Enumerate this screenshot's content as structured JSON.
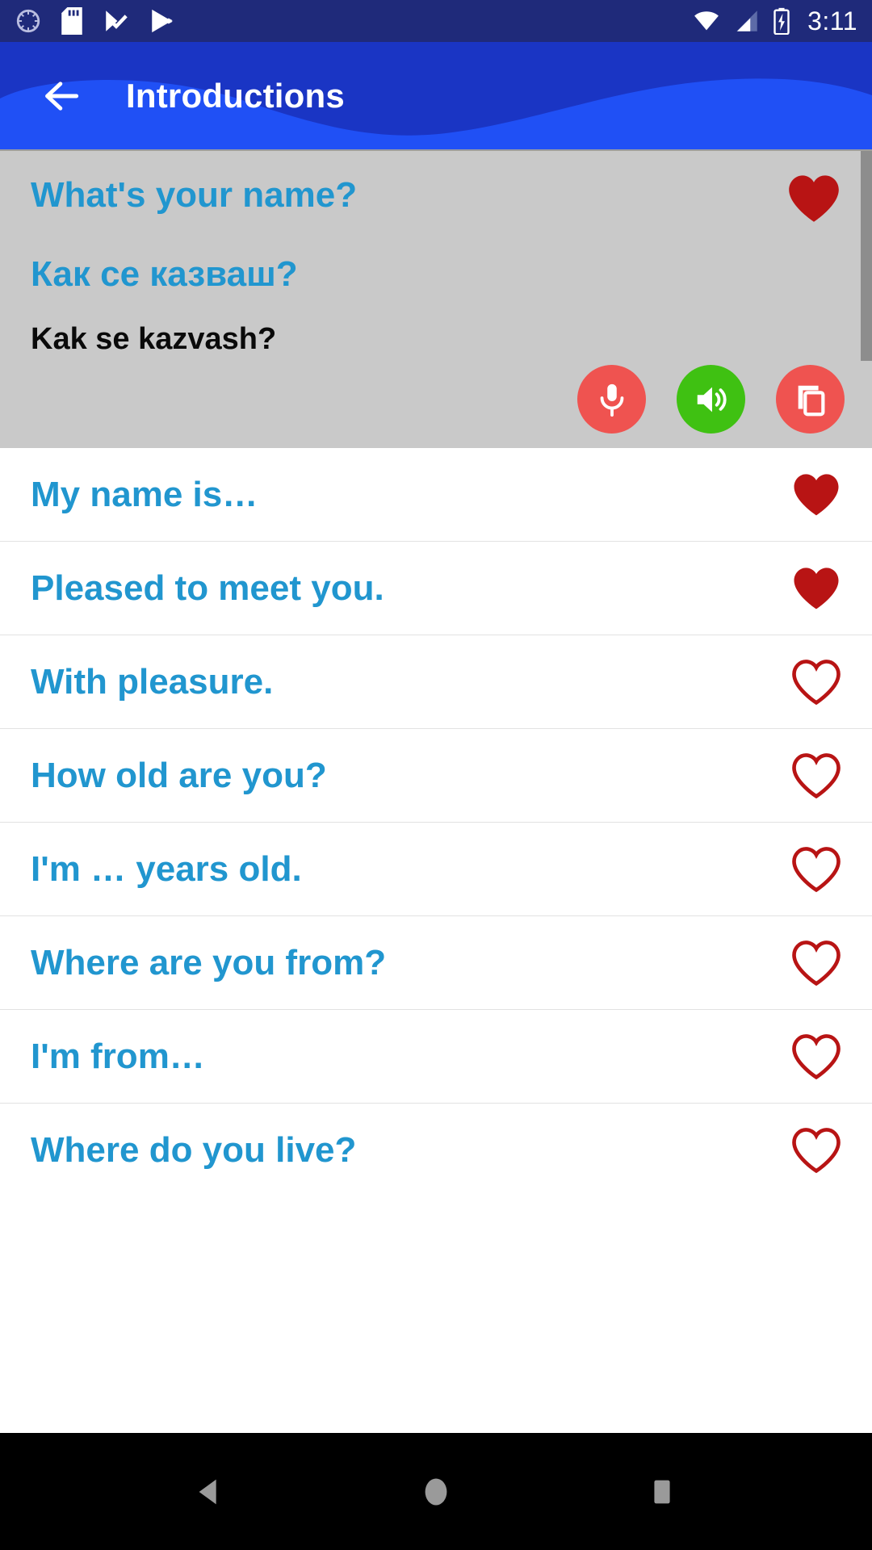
{
  "status_bar": {
    "time": "3:11",
    "left_icons": [
      {
        "name": "sync-circle-icon"
      },
      {
        "name": "sd-card-icon"
      },
      {
        "name": "video-check-icon"
      },
      {
        "name": "play-store-icon"
      }
    ],
    "right_icons": [
      {
        "name": "wifi-icon"
      },
      {
        "name": "cellular-signal-icon"
      },
      {
        "name": "battery-charging-icon"
      }
    ],
    "background_color": "#1f2a7a"
  },
  "app_bar": {
    "title": "Introductions",
    "back_icon": "arrow-left-icon",
    "background_color": "#1a35c4",
    "wave_color": "#2050f5"
  },
  "featured_card": {
    "english": "What's your name?",
    "native": "Как се казваш?",
    "transliteration": "Kak se kazvash?",
    "favorited": true,
    "heart_color": "#b81414",
    "background_color": "#c9c9c9",
    "text_color": "#2196cf",
    "translit_color": "#0a0a0a",
    "actions": [
      {
        "name": "record-button",
        "icon": "microphone-icon",
        "color": "#ef5350"
      },
      {
        "name": "play-audio-button",
        "icon": "speaker-icon",
        "color": "#3fc112"
      },
      {
        "name": "copy-button",
        "icon": "copy-icon",
        "color": "#ef5350"
      }
    ]
  },
  "phrase_list": {
    "accent_color": "#2196cf",
    "heart_color": "#b81414",
    "items": [
      {
        "label": "My name is…",
        "favorited": true
      },
      {
        "label": "Pleased to meet you.",
        "favorited": true
      },
      {
        "label": "With pleasure.",
        "favorited": false
      },
      {
        "label": "How old are you?",
        "favorited": false
      },
      {
        "label": "I'm … years old.",
        "favorited": false
      },
      {
        "label": "Where are you from?",
        "favorited": false
      },
      {
        "label": "I'm from…",
        "favorited": false
      },
      {
        "label": "Where do you live?",
        "favorited": false
      }
    ]
  },
  "nav_bar": {
    "background_color": "#000000",
    "buttons": [
      {
        "name": "nav-back-button",
        "icon": "triangle-left-icon"
      },
      {
        "name": "nav-home-button",
        "icon": "circle-icon"
      },
      {
        "name": "nav-recents-button",
        "icon": "square-icon"
      }
    ]
  }
}
